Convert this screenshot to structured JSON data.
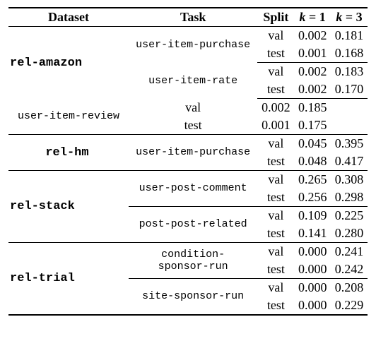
{
  "chart_data": {
    "type": "table",
    "title": "",
    "columns": [
      "Dataset",
      "Task",
      "Split",
      "k = 1",
      "k = 3"
    ],
    "rows": [
      {
        "dataset": "rel-amazon",
        "task": "user-item-purchase",
        "split": "val",
        "k1": "0.002",
        "k3": "0.181"
      },
      {
        "dataset": "rel-amazon",
        "task": "user-item-purchase",
        "split": "test",
        "k1": "0.001",
        "k3": "0.168"
      },
      {
        "dataset": "rel-amazon",
        "task": "user-item-rate",
        "split": "val",
        "k1": "0.002",
        "k3": "0.183"
      },
      {
        "dataset": "rel-amazon",
        "task": "user-item-rate",
        "split": "test",
        "k1": "0.002",
        "k3": "0.170"
      },
      {
        "dataset": "rel-amazon",
        "task": "user-item-review",
        "split": "val",
        "k1": "0.002",
        "k3": "0.185"
      },
      {
        "dataset": "rel-amazon",
        "task": "user-item-review",
        "split": "test",
        "k1": "0.001",
        "k3": "0.175"
      },
      {
        "dataset": "rel-hm",
        "task": "user-item-purchase",
        "split": "val",
        "k1": "0.045",
        "k3": "0.395"
      },
      {
        "dataset": "rel-hm",
        "task": "user-item-purchase",
        "split": "test",
        "k1": "0.048",
        "k3": "0.417"
      },
      {
        "dataset": "rel-stack",
        "task": "user-post-comment",
        "split": "val",
        "k1": "0.265",
        "k3": "0.308"
      },
      {
        "dataset": "rel-stack",
        "task": "user-post-comment",
        "split": "test",
        "k1": "0.256",
        "k3": "0.298"
      },
      {
        "dataset": "rel-stack",
        "task": "post-post-related",
        "split": "val",
        "k1": "0.109",
        "k3": "0.225"
      },
      {
        "dataset": "rel-stack",
        "task": "post-post-related",
        "split": "test",
        "k1": "0.141",
        "k3": "0.280"
      },
      {
        "dataset": "rel-trial",
        "task": "condition-sponsor-run",
        "split": "val",
        "k1": "0.000",
        "k3": "0.241"
      },
      {
        "dataset": "rel-trial",
        "task": "condition-sponsor-run",
        "split": "test",
        "k1": "0.000",
        "k3": "0.242"
      },
      {
        "dataset": "rel-trial",
        "task": "site-sponsor-run",
        "split": "val",
        "k1": "0.000",
        "k3": "0.208"
      },
      {
        "dataset": "rel-trial",
        "task": "site-sponsor-run",
        "split": "test",
        "k1": "0.000",
        "k3": "0.229"
      }
    ]
  },
  "header": {
    "dataset": "Dataset",
    "task": "Task",
    "split": "Split",
    "k1_a": "k",
    "k1_b": " = 1",
    "k3_a": "k",
    "k3_b": " = 3"
  },
  "datasets": {
    "amazon": "rel-amazon",
    "hm": "rel-hm",
    "stack": "rel-stack",
    "trial": "rel-trial"
  },
  "tasks": {
    "uip": "user-item-purchase",
    "uir": "user-item-rate",
    "uirev": "user-item-review",
    "upc": "user-post-comment",
    "ppr": "post-post-related",
    "csr1": "condition-",
    "csr2": "sponsor-run",
    "ssr": "site-sponsor-run"
  },
  "splits": {
    "val": "val",
    "test": "test"
  },
  "v": {
    "r0k1": "0.002",
    "r0k3": "0.181",
    "r1k1": "0.001",
    "r1k3": "0.168",
    "r2k1": "0.002",
    "r2k3": "0.183",
    "r3k1": "0.002",
    "r3k3": "0.170",
    "r4k1": "0.002",
    "r4k3": "0.185",
    "r5k1": "0.001",
    "r5k3": "0.175",
    "r6k1": "0.045",
    "r6k3": "0.395",
    "r7k1": "0.048",
    "r7k3": "0.417",
    "r8k1": "0.265",
    "r8k3": "0.308",
    "r9k1": "0.256",
    "r9k3": "0.298",
    "r10k1": "0.109",
    "r10k3": "0.225",
    "r11k1": "0.141",
    "r11k3": "0.280",
    "r12k1": "0.000",
    "r12k3": "0.241",
    "r13k1": "0.000",
    "r13k3": "0.242",
    "r14k1": "0.000",
    "r14k3": "0.208",
    "r15k1": "0.000",
    "r15k3": "0.229"
  }
}
